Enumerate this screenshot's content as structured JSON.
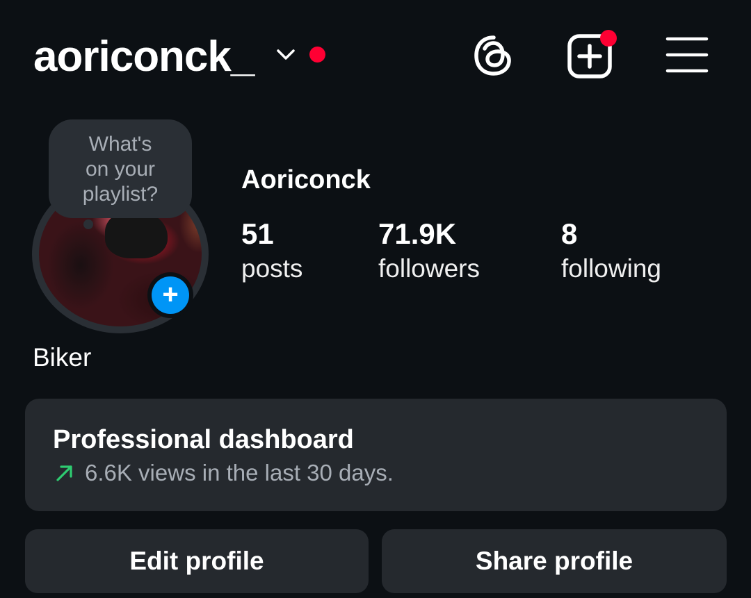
{
  "header": {
    "username": "aoriconck_",
    "account_switcher_icon": "chevron-down-icon",
    "has_unread_indicator": true,
    "unread_color": "#ff0033",
    "actions": [
      {
        "icon": "threads-icon"
      },
      {
        "icon": "create-post-icon",
        "has_badge": true
      },
      {
        "icon": "hamburger-menu-icon"
      }
    ]
  },
  "note": {
    "placeholder": "What's on your playlist?",
    "lines": [
      "What's",
      "on your",
      "playlist?"
    ]
  },
  "profile": {
    "display_name": "Aoriconck",
    "bio": "Biker",
    "add_story_icon": "plus-icon",
    "stats": {
      "posts": {
        "value": "51",
        "label": "posts"
      },
      "followers": {
        "value": "71.9K",
        "label": "followers"
      },
      "following": {
        "value": "8",
        "label": "following"
      }
    }
  },
  "dashboard": {
    "title": "Professional dashboard",
    "subtitle": "6.6K views in the last 30 days.",
    "trend_icon": "trend-up-arrow-icon",
    "trend_color": "#2ecc71"
  },
  "buttons": {
    "edit_profile": "Edit profile",
    "share_profile": "Share profile"
  },
  "colors": {
    "background": "#0c1014",
    "card": "#25292e",
    "accent_blue": "#0095f6"
  }
}
